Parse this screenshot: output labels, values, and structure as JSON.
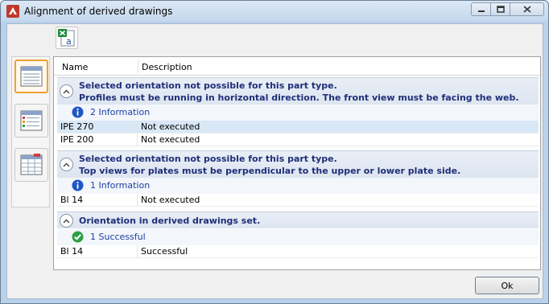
{
  "window": {
    "title": "Alignment of derived drawings",
    "accent": "#c0392b"
  },
  "toolbar": {
    "export_icon": "excel-export-icon"
  },
  "sidebar": {
    "items": [
      {
        "icon": "list-view-icon",
        "active": true
      },
      {
        "icon": "color-list-view-icon",
        "active": false
      },
      {
        "icon": "table-view-icon",
        "active": false
      }
    ]
  },
  "table": {
    "columns": [
      "Name",
      "Description"
    ],
    "groups": [
      {
        "title_lines": [
          "Selected orientation not possible for this part type.",
          "Profiles must be running in horizontal direction. The front view must be facing the web."
        ],
        "summary": "2 Information",
        "summary_icon": "info-icon",
        "rows": [
          {
            "name": "IPE 270",
            "description": "Not executed",
            "selected": true
          },
          {
            "name": "IPE 200",
            "description": "Not executed",
            "selected": false
          }
        ]
      },
      {
        "title_lines": [
          "Selected orientation not possible for this part type.",
          "Top views for plates must be perpendicular to the upper or lower plate side."
        ],
        "summary": "1 Information",
        "summary_icon": "info-icon",
        "rows": [
          {
            "name": "Bl 14",
            "description": "Not executed",
            "selected": false
          }
        ]
      },
      {
        "title_lines": [
          "Orientation in derived drawings set."
        ],
        "summary": "1 Successful",
        "summary_icon": "success-check-icon",
        "rows": [
          {
            "name": "Bl 14",
            "description": "Successful",
            "selected": false
          }
        ]
      }
    ]
  },
  "footer": {
    "ok_label": "Ok"
  }
}
